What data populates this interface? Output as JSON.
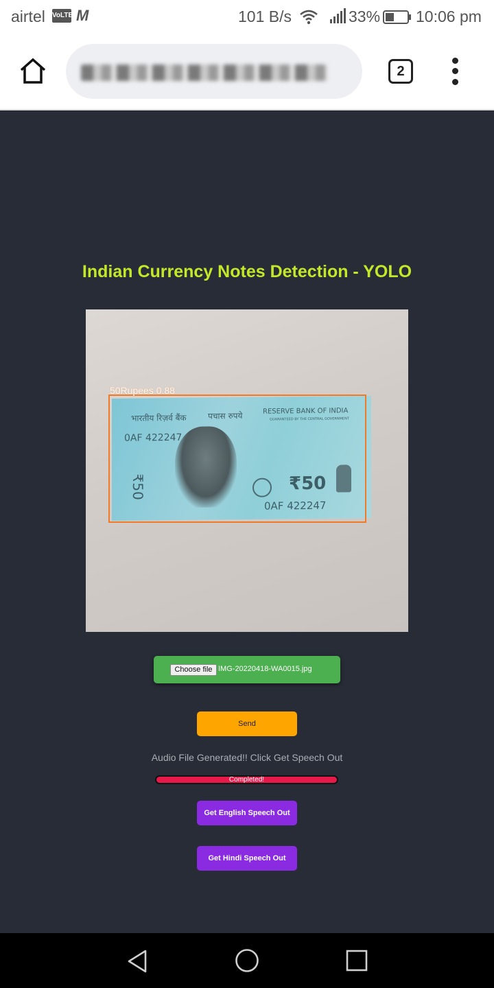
{
  "status_bar": {
    "carrier": "airtel",
    "volte": "VoLTE",
    "network_speed": "101 B/s",
    "battery_percent": "33%",
    "time": "10:06 pm",
    "icons": [
      "m-icon",
      "wifi-icon",
      "signal-icon",
      "battery-icon"
    ]
  },
  "browser": {
    "tab_count": "2",
    "icons": [
      "home-icon",
      "tabs-icon",
      "more-menu-icon"
    ]
  },
  "page": {
    "title": "Indian Currency Notes Detection - YOLO",
    "detection": {
      "label": "50Rupees 0.88",
      "box_color": "#f07a28"
    },
    "note_text": {
      "hindi_bank": "भारतीय रिज़र्व बैंक",
      "hindi_value": "पचास रुपये",
      "bank_name": "RESERVE BANK OF INDIA",
      "guarantee": "GUARANTEED BY THE CENTRAL GOVERNMENT",
      "serial_top": "0AF 422247",
      "serial_bottom": "0AF 422247",
      "denomination": "₹50",
      "side_value": "₹50"
    },
    "file_input": {
      "button_label": "Choose file",
      "file_name": "IMG-20220418-WA0015.jpg"
    },
    "send_label": "Send",
    "status_message": "Audio File Generated!! Click Get Speech Out",
    "progress": {
      "label": "Completed!",
      "fraction": 1.0
    },
    "english_speech_label": "Get English Speech Out",
    "hindi_speech_label": "Get Hindi Speech Out"
  },
  "colors": {
    "title": "#c3e82a",
    "file_input_bg": "#4caf50",
    "send_bg": "#ffa500",
    "progress_bg": "#e6194b",
    "speech_bg": "#8a2be2",
    "page_bg": "#282c36"
  },
  "nav_icons": [
    "back-icon",
    "home-circle-icon",
    "recents-icon"
  ]
}
